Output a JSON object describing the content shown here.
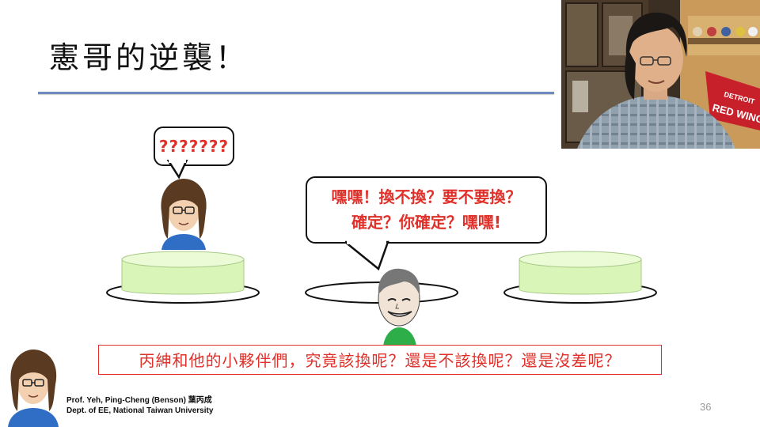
{
  "slide": {
    "title": "憲哥的逆襲！",
    "page_number": "36",
    "speech_small": "???????",
    "speech_big_line1": "嘿嘿！換不換？要不要換？",
    "speech_big_line2": "確定？你確定？嘿嘿!",
    "caption": "丙紳和他的小夥伴們，究竟該換呢？還是不該換呢？還是沒差呢？",
    "credit_line1": "Prof. Yeh, Ping-Cheng (Benson) 葉丙成",
    "credit_line2": "Dept. of EE,  National Taiwan University"
  },
  "webcam": {
    "pennant_text_1": "DETROIT",
    "pennant_text_2": "RED WINGS"
  },
  "colors": {
    "accent_red": "#e0302a",
    "rule_blue": "#6f8bbd",
    "box_green": "#d9f5b8"
  }
}
